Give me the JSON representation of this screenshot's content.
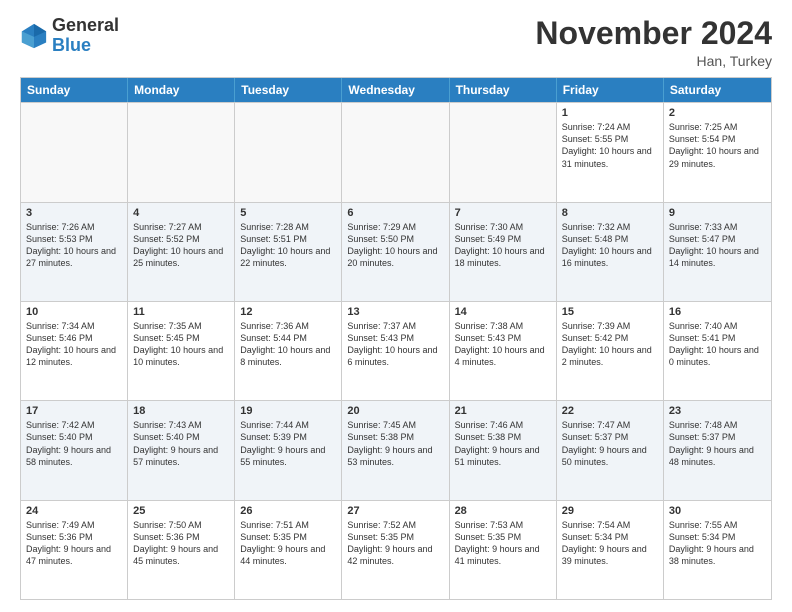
{
  "header": {
    "logo_general": "General",
    "logo_blue": "Blue",
    "month_title": "November 2024",
    "location": "Han, Turkey"
  },
  "days_of_week": [
    "Sunday",
    "Monday",
    "Tuesday",
    "Wednesday",
    "Thursday",
    "Friday",
    "Saturday"
  ],
  "weeks": [
    {
      "cells": [
        {
          "day": "",
          "empty": true
        },
        {
          "day": "",
          "empty": true
        },
        {
          "day": "",
          "empty": true
        },
        {
          "day": "",
          "empty": true
        },
        {
          "day": "",
          "empty": true
        },
        {
          "day": "1",
          "sunrise": "Sunrise: 7:24 AM",
          "sunset": "Sunset: 5:55 PM",
          "daylight": "Daylight: 10 hours and 31 minutes."
        },
        {
          "day": "2",
          "sunrise": "Sunrise: 7:25 AM",
          "sunset": "Sunset: 5:54 PM",
          "daylight": "Daylight: 10 hours and 29 minutes."
        }
      ]
    },
    {
      "cells": [
        {
          "day": "3",
          "sunrise": "Sunrise: 7:26 AM",
          "sunset": "Sunset: 5:53 PM",
          "daylight": "Daylight: 10 hours and 27 minutes."
        },
        {
          "day": "4",
          "sunrise": "Sunrise: 7:27 AM",
          "sunset": "Sunset: 5:52 PM",
          "daylight": "Daylight: 10 hours and 25 minutes."
        },
        {
          "day": "5",
          "sunrise": "Sunrise: 7:28 AM",
          "sunset": "Sunset: 5:51 PM",
          "daylight": "Daylight: 10 hours and 22 minutes."
        },
        {
          "day": "6",
          "sunrise": "Sunrise: 7:29 AM",
          "sunset": "Sunset: 5:50 PM",
          "daylight": "Daylight: 10 hours and 20 minutes."
        },
        {
          "day": "7",
          "sunrise": "Sunrise: 7:30 AM",
          "sunset": "Sunset: 5:49 PM",
          "daylight": "Daylight: 10 hours and 18 minutes."
        },
        {
          "day": "8",
          "sunrise": "Sunrise: 7:32 AM",
          "sunset": "Sunset: 5:48 PM",
          "daylight": "Daylight: 10 hours and 16 minutes."
        },
        {
          "day": "9",
          "sunrise": "Sunrise: 7:33 AM",
          "sunset": "Sunset: 5:47 PM",
          "daylight": "Daylight: 10 hours and 14 minutes."
        }
      ]
    },
    {
      "cells": [
        {
          "day": "10",
          "sunrise": "Sunrise: 7:34 AM",
          "sunset": "Sunset: 5:46 PM",
          "daylight": "Daylight: 10 hours and 12 minutes."
        },
        {
          "day": "11",
          "sunrise": "Sunrise: 7:35 AM",
          "sunset": "Sunset: 5:45 PM",
          "daylight": "Daylight: 10 hours and 10 minutes."
        },
        {
          "day": "12",
          "sunrise": "Sunrise: 7:36 AM",
          "sunset": "Sunset: 5:44 PM",
          "daylight": "Daylight: 10 hours and 8 minutes."
        },
        {
          "day": "13",
          "sunrise": "Sunrise: 7:37 AM",
          "sunset": "Sunset: 5:43 PM",
          "daylight": "Daylight: 10 hours and 6 minutes."
        },
        {
          "day": "14",
          "sunrise": "Sunrise: 7:38 AM",
          "sunset": "Sunset: 5:43 PM",
          "daylight": "Daylight: 10 hours and 4 minutes."
        },
        {
          "day": "15",
          "sunrise": "Sunrise: 7:39 AM",
          "sunset": "Sunset: 5:42 PM",
          "daylight": "Daylight: 10 hours and 2 minutes."
        },
        {
          "day": "16",
          "sunrise": "Sunrise: 7:40 AM",
          "sunset": "Sunset: 5:41 PM",
          "daylight": "Daylight: 10 hours and 0 minutes."
        }
      ]
    },
    {
      "cells": [
        {
          "day": "17",
          "sunrise": "Sunrise: 7:42 AM",
          "sunset": "Sunset: 5:40 PM",
          "daylight": "Daylight: 9 hours and 58 minutes."
        },
        {
          "day": "18",
          "sunrise": "Sunrise: 7:43 AM",
          "sunset": "Sunset: 5:40 PM",
          "daylight": "Daylight: 9 hours and 57 minutes."
        },
        {
          "day": "19",
          "sunrise": "Sunrise: 7:44 AM",
          "sunset": "Sunset: 5:39 PM",
          "daylight": "Daylight: 9 hours and 55 minutes."
        },
        {
          "day": "20",
          "sunrise": "Sunrise: 7:45 AM",
          "sunset": "Sunset: 5:38 PM",
          "daylight": "Daylight: 9 hours and 53 minutes."
        },
        {
          "day": "21",
          "sunrise": "Sunrise: 7:46 AM",
          "sunset": "Sunset: 5:38 PM",
          "daylight": "Daylight: 9 hours and 51 minutes."
        },
        {
          "day": "22",
          "sunrise": "Sunrise: 7:47 AM",
          "sunset": "Sunset: 5:37 PM",
          "daylight": "Daylight: 9 hours and 50 minutes."
        },
        {
          "day": "23",
          "sunrise": "Sunrise: 7:48 AM",
          "sunset": "Sunset: 5:37 PM",
          "daylight": "Daylight: 9 hours and 48 minutes."
        }
      ]
    },
    {
      "cells": [
        {
          "day": "24",
          "sunrise": "Sunrise: 7:49 AM",
          "sunset": "Sunset: 5:36 PM",
          "daylight": "Daylight: 9 hours and 47 minutes."
        },
        {
          "day": "25",
          "sunrise": "Sunrise: 7:50 AM",
          "sunset": "Sunset: 5:36 PM",
          "daylight": "Daylight: 9 hours and 45 minutes."
        },
        {
          "day": "26",
          "sunrise": "Sunrise: 7:51 AM",
          "sunset": "Sunset: 5:35 PM",
          "daylight": "Daylight: 9 hours and 44 minutes."
        },
        {
          "day": "27",
          "sunrise": "Sunrise: 7:52 AM",
          "sunset": "Sunset: 5:35 PM",
          "daylight": "Daylight: 9 hours and 42 minutes."
        },
        {
          "day": "28",
          "sunrise": "Sunrise: 7:53 AM",
          "sunset": "Sunset: 5:35 PM",
          "daylight": "Daylight: 9 hours and 41 minutes."
        },
        {
          "day": "29",
          "sunrise": "Sunrise: 7:54 AM",
          "sunset": "Sunset: 5:34 PM",
          "daylight": "Daylight: 9 hours and 39 minutes."
        },
        {
          "day": "30",
          "sunrise": "Sunrise: 7:55 AM",
          "sunset": "Sunset: 5:34 PM",
          "daylight": "Daylight: 9 hours and 38 minutes."
        }
      ]
    }
  ]
}
